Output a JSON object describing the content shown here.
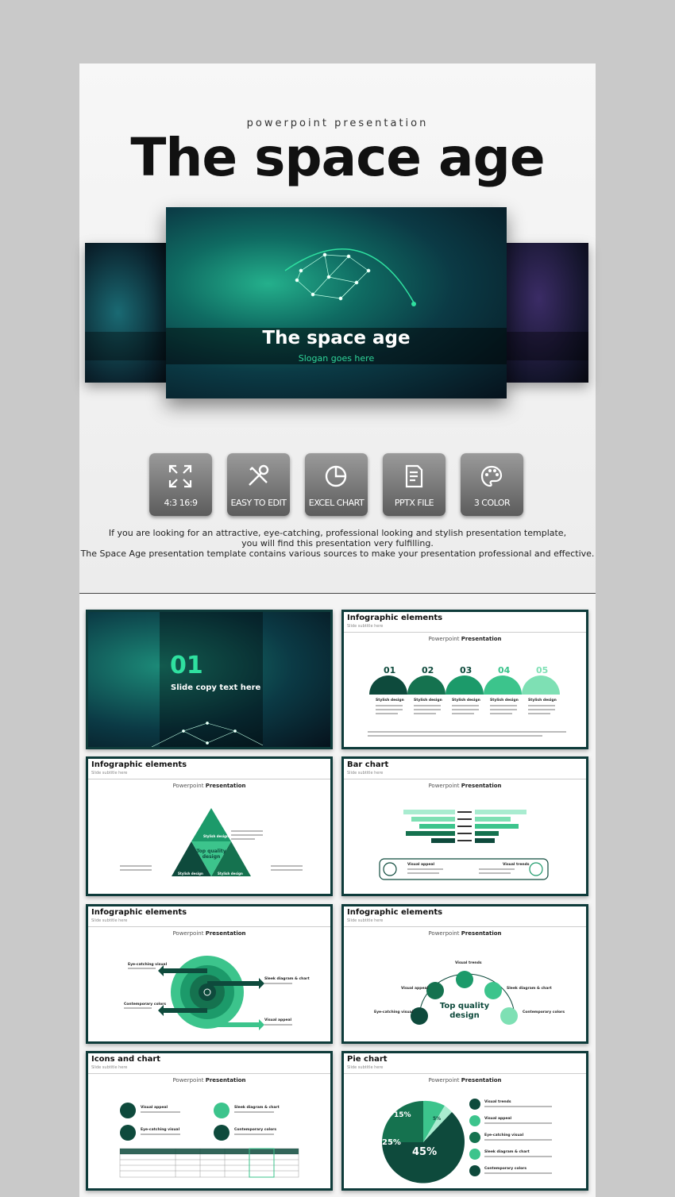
{
  "header": {
    "subtitle": "powerpoint presentation",
    "title": "The space age"
  },
  "cover_slide": {
    "title": "The space age",
    "slogan": "Slogan goes here"
  },
  "features": [
    {
      "label": "4:3 16:9",
      "icon": "resize-icon"
    },
    {
      "label": "EASY TO EDIT",
      "icon": "tools-icon"
    },
    {
      "label": "EXCEL CHART",
      "icon": "pie-chart-icon"
    },
    {
      "label": "PPTX FILE",
      "icon": "document-icon"
    },
    {
      "label": "3 COLOR",
      "icon": "palette-icon"
    }
  ],
  "description": {
    "line1": "If you are looking for an attractive, eye-catching, professional looking and stylish presentation template,",
    "line2": "you will find this presentation very fulfilling.",
    "line3": "The Space Age presentation template contains various sources to make your presentation professional and effective."
  },
  "thumbnails": [
    {
      "title": "",
      "number": "01",
      "caption": "Slide copy text here"
    },
    {
      "title": "Infographic elements",
      "numbers": [
        "01",
        "02",
        "03",
        "04",
        "05"
      ],
      "labels": [
        "Stylish design",
        "Stylish design",
        "Stylish design",
        "Stylish design",
        "Stylish design"
      ]
    },
    {
      "title": "Infographic elements",
      "center": "Top quality design",
      "labels": [
        "Stylish design",
        "Stylish design",
        "Stylish design"
      ]
    },
    {
      "title": "Bar chart",
      "labels": [
        "Visual appeal",
        "Visual trends"
      ]
    },
    {
      "title": "Infographic elements",
      "labels": [
        "Eye-catching visual",
        "Sleek diagram & chart",
        "Contemporary colors",
        "Visual appeal"
      ]
    },
    {
      "title": "Infographic elements",
      "center": "Top quality design",
      "labels": [
        "Visual trends",
        "Visual appeal",
        "Sleek diagram & chart",
        "Eye-catching visual",
        "Contemporary colors"
      ]
    },
    {
      "title": "Icons and chart",
      "labels": [
        "Visual appeal",
        "Sleek diagram & chart",
        "Eye-catching visual",
        "Contemporary colors"
      ]
    },
    {
      "title": "Pie chart",
      "slices": [
        "15%",
        "5%",
        "25%",
        "45%"
      ],
      "labels": [
        "Visual trends",
        "Visual appeal",
        "Eye-catching visual",
        "Sleek diagram & chart",
        "Contemporary colors"
      ]
    }
  ],
  "common": {
    "subtitle": "Slide subtitle here",
    "pp_left": "Powerpoint",
    "pp_right": "Presentation"
  },
  "colors": {
    "accent": "#2fe0a0",
    "dark_green": "#0e4a3c",
    "mid_green": "#1c9a6a"
  }
}
